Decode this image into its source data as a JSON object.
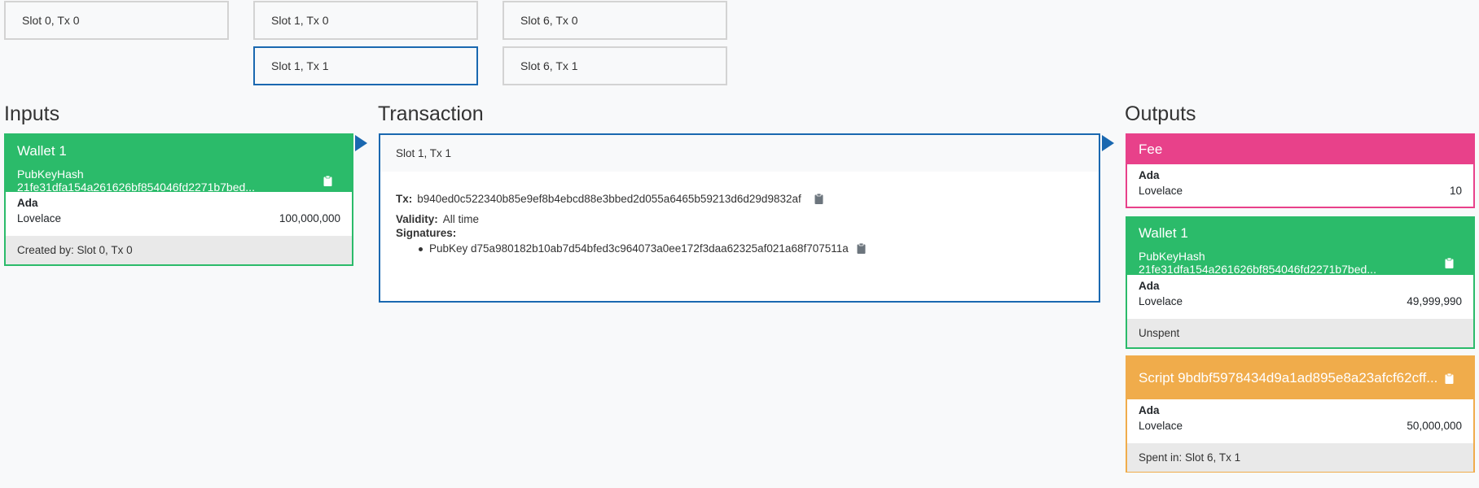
{
  "slots": {
    "s0t0": "Slot 0, Tx 0",
    "s1t0": "Slot 1, Tx 0",
    "s1t1": "Slot 1, Tx 1",
    "s6t0": "Slot 6, Tx 0",
    "s6t1": "Slot 6, Tx 1"
  },
  "inputs": {
    "title": "Inputs",
    "card": {
      "name": "Wallet 1",
      "hash": "PubKeyHash 21fe31dfa154a261626bf854046fd2271b7bed...",
      "asset": "Ada",
      "token": "Lovelace",
      "amount": "100,000,000",
      "footer": "Created by: Slot 0, Tx 0"
    }
  },
  "transaction": {
    "title": "Transaction",
    "header": "Slot 1, Tx 1",
    "tx_label": "Tx:",
    "tx_hash": "b940ed0c522340b85e9ef8b4ebcd88e3bbed2d055a6465b59213d6d29d9832af",
    "validity_label": "Validity:",
    "validity_value": "All time",
    "signatures_label": "Signatures:",
    "signature": "PubKey d75a980182b10ab7d54bfed3c964073a0ee172f3daa62325af021a68f707511a"
  },
  "outputs": {
    "title": "Outputs",
    "fee": {
      "name": "Fee",
      "asset": "Ada",
      "token": "Lovelace",
      "amount": "10"
    },
    "wallet": {
      "name": "Wallet 1",
      "hash": "PubKeyHash 21fe31dfa154a261626bf854046fd2271b7bed...",
      "asset": "Ada",
      "token": "Lovelace",
      "amount": "49,999,990",
      "footer": "Unspent"
    },
    "script": {
      "name": "Script 9bdbf5978434d9a1ad895e8a23afcf62cff...",
      "asset": "Ada",
      "token": "Lovelace",
      "amount": "50,000,000",
      "footer": "Spent in: Slot 6, Tx 1"
    }
  },
  "colors": {
    "green": "#2bbb6a",
    "pink": "#e8418a",
    "orange": "#f0ac4b",
    "blue": "#1a68b0",
    "footer_bg": "#e9e9e9"
  },
  "icons": {
    "clipboard": "clipboard-icon",
    "arrow": "play-arrow-icon"
  }
}
